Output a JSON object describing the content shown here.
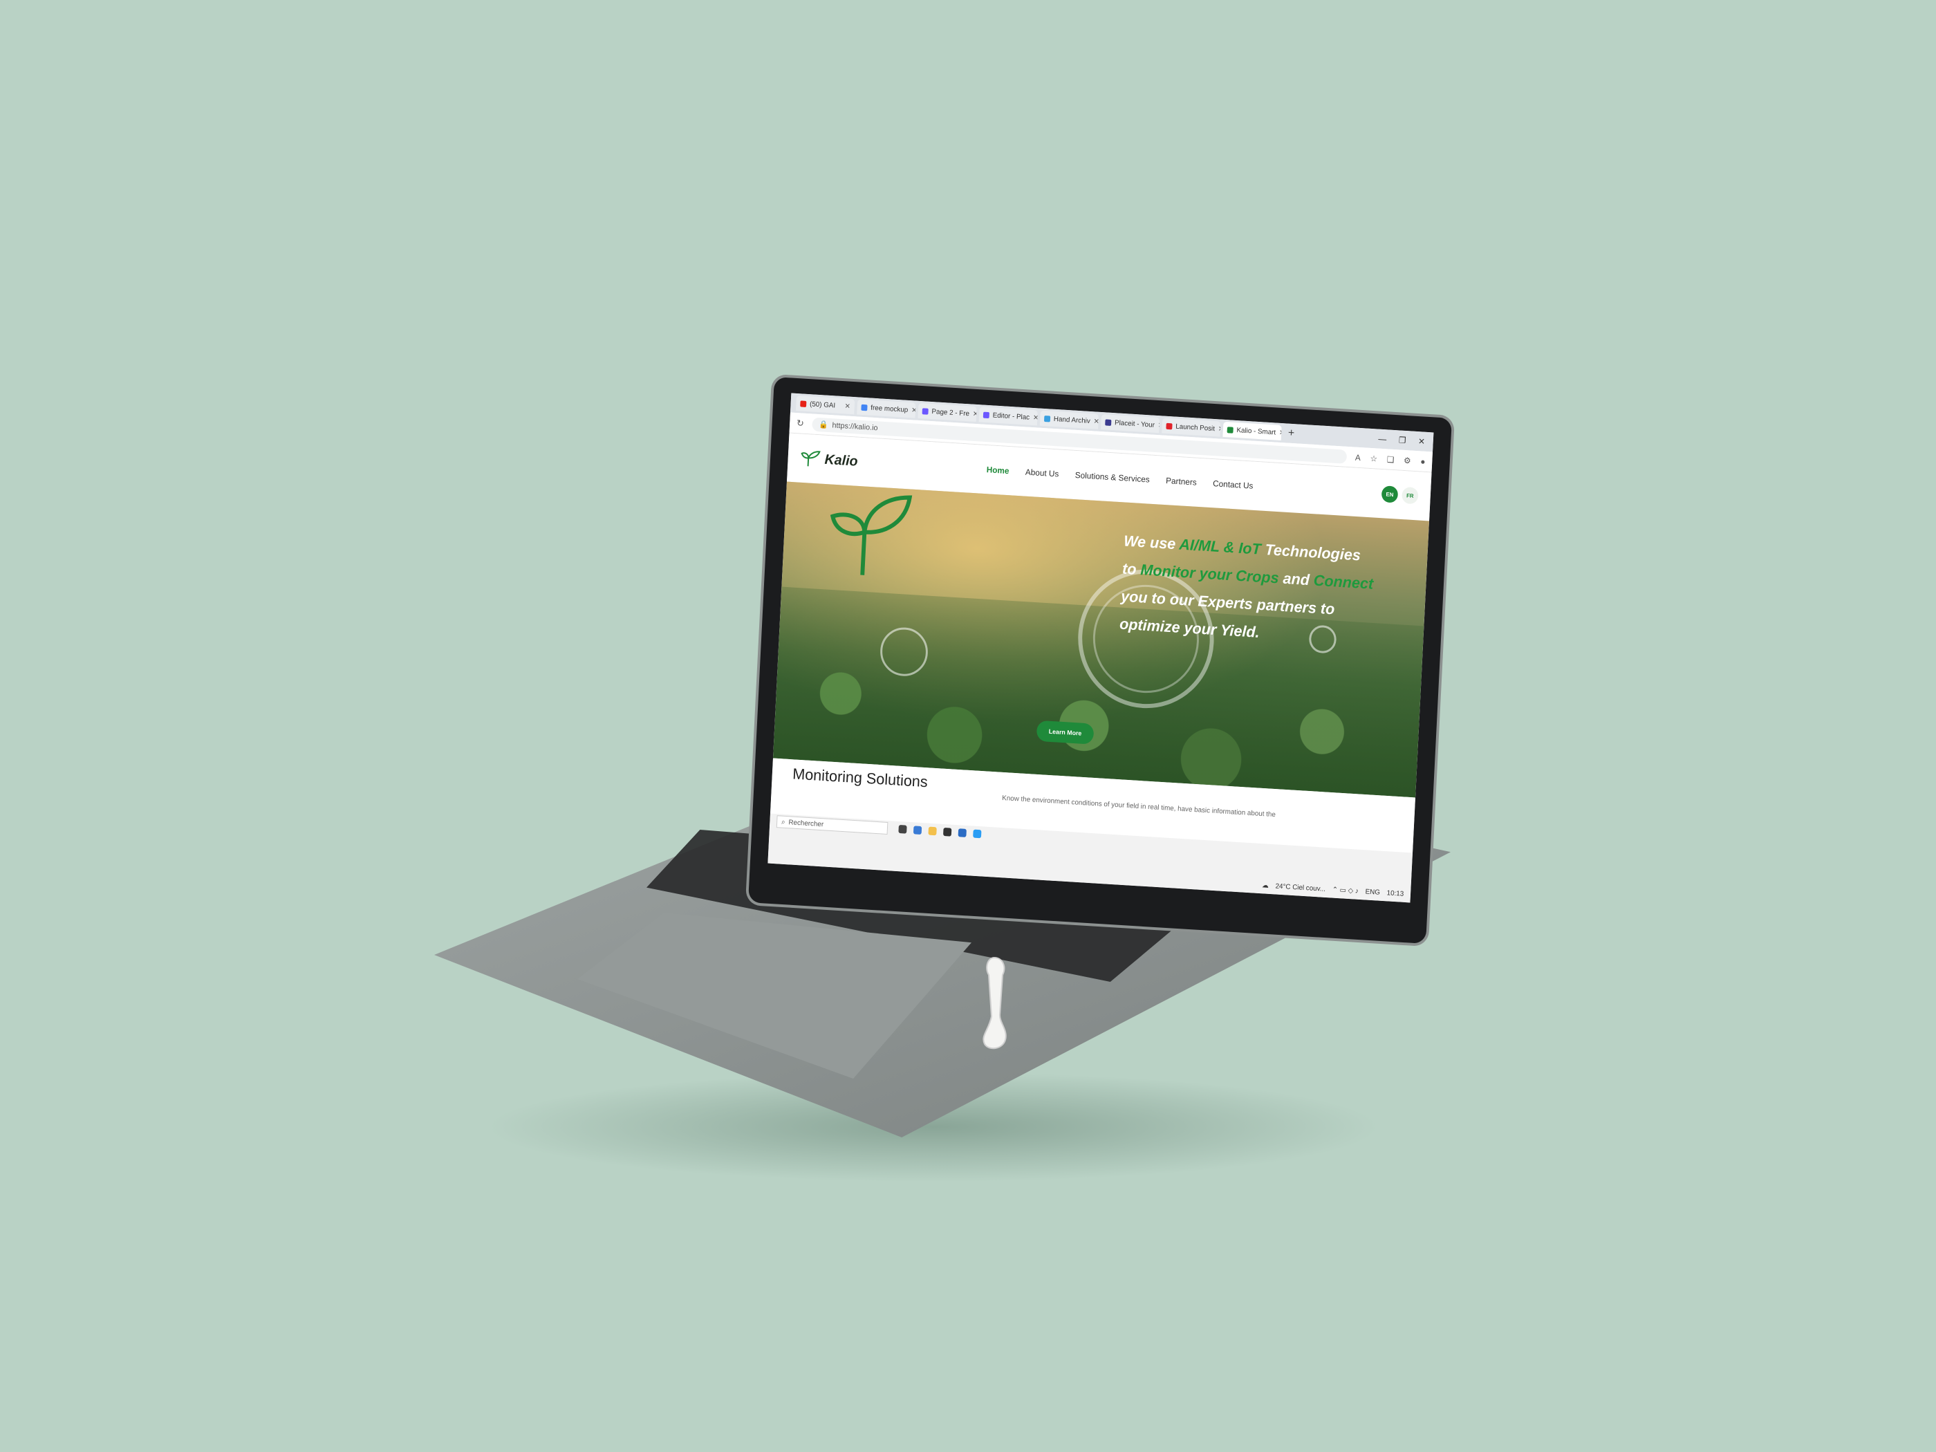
{
  "browser": {
    "tabs": [
      {
        "label": "(50) GAI",
        "favicon_color": "#e62117",
        "active": false
      },
      {
        "label": "free mockup",
        "favicon_color": "#4285f4",
        "active": false
      },
      {
        "label": "Page 2 - Fre",
        "favicon_color": "#6b57ff",
        "active": false
      },
      {
        "label": "Editor - Plac",
        "favicon_color": "#6b57ff",
        "active": false
      },
      {
        "label": "Hand Archiv",
        "favicon_color": "#3aa0e0",
        "active": false
      },
      {
        "label": "Placeit - Your",
        "favicon_color": "#3b3b8f",
        "active": false
      },
      {
        "label": "Launch Posit",
        "favicon_color": "#e0222a",
        "active": false
      },
      {
        "label": "Kalio - Smart",
        "favicon_color": "#1f8a3a",
        "active": true
      }
    ],
    "new_tab": "+",
    "window_controls": [
      "—",
      "❐",
      "✕"
    ],
    "url": "https://kalio.io"
  },
  "site": {
    "brand": "Kalio",
    "nav": [
      "Home",
      "About Us",
      "Solutions & Services",
      "Partners",
      "Contact Us"
    ],
    "lang_en": "EN",
    "lang_fr": "FR"
  },
  "hero": {
    "line1_a": "We use ",
    "line1_b": "AI/ML & IoT",
    "line1_c": " Technologies",
    "line2_a": "to ",
    "line2_b": "Monitor your Crops",
    "line2_c": " and ",
    "line2_d": "Connect",
    "line3": "you to our Experts partners to",
    "line4": "optimize your Yield.",
    "cta": "Learn More"
  },
  "section": {
    "title": "Monitoring Solutions",
    "desc": "Know the environment conditions of your field in real time, have basic information about the"
  },
  "taskbar": {
    "search_placeholder": "Rechercher",
    "weather": "24°C  Ciel couv...",
    "lang": "ENG",
    "time": "10:13"
  },
  "colors": {
    "accent": "#1f8a3a",
    "background": "#b9d2c5"
  }
}
